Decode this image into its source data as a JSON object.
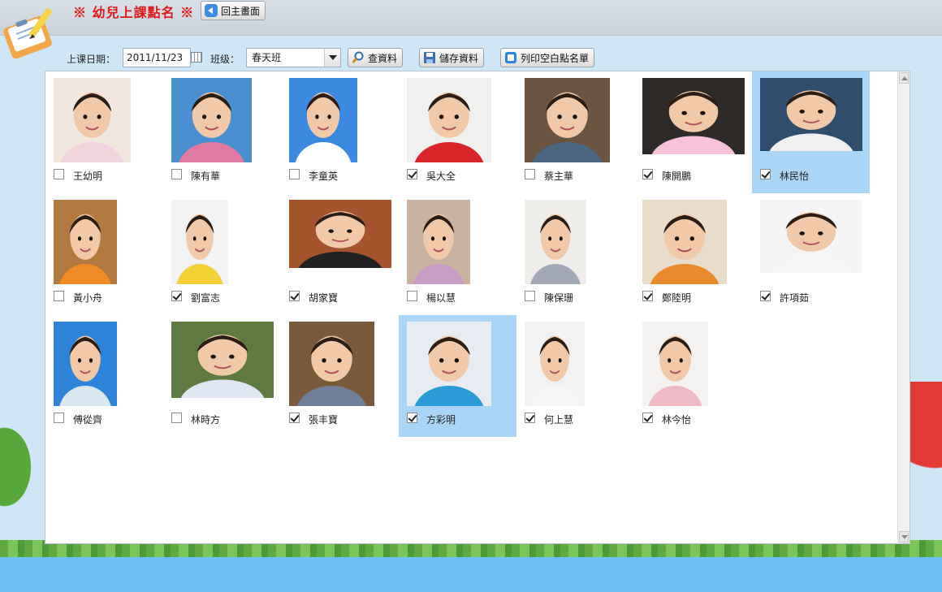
{
  "header": {
    "title": "※ 幼兒上課點名 ※",
    "home_label": "回主畫面"
  },
  "toolbar": {
    "date_label": "上课日期：",
    "date_value": "2011/11/23",
    "class_label": "班级：",
    "class_value": "春天班",
    "query_label": "查資料",
    "save_label": "儲存資料",
    "print_label": "列印空白點名單"
  },
  "students": [
    {
      "name": "王幼明",
      "checked": false,
      "selected": false
    },
    {
      "name": "陳有華",
      "checked": false,
      "selected": false
    },
    {
      "name": "李童英",
      "checked": false,
      "selected": false
    },
    {
      "name": "吳大全",
      "checked": true,
      "selected": false
    },
    {
      "name": "蔡主華",
      "checked": false,
      "selected": false
    },
    {
      "name": "陳開鵬",
      "checked": true,
      "selected": false
    },
    {
      "name": "林民怡",
      "checked": true,
      "selected": true
    },
    {
      "name": "黃小舟",
      "checked": false,
      "selected": false
    },
    {
      "name": "劉富志",
      "checked": true,
      "selected": false
    },
    {
      "name": "胡家寶",
      "checked": true,
      "selected": false
    },
    {
      "name": "楊以慧",
      "checked": false,
      "selected": false
    },
    {
      "name": "陳保珊",
      "checked": false,
      "selected": false
    },
    {
      "name": "鄭陸明",
      "checked": true,
      "selected": false
    },
    {
      "name": "許項茹",
      "checked": true,
      "selected": false
    },
    {
      "name": "傅從齊",
      "checked": false,
      "selected": false
    },
    {
      "name": "林時方",
      "checked": false,
      "selected": false
    },
    {
      "name": "張丰寶",
      "checked": true,
      "selected": false
    },
    {
      "name": "方彩明",
      "checked": true,
      "selected": true
    },
    {
      "name": "何上慧",
      "checked": true,
      "selected": false
    },
    {
      "name": "林今怡",
      "checked": true,
      "selected": false
    }
  ],
  "colors": {
    "title": "#e01818",
    "selected_bg": "#a9d6f7"
  }
}
